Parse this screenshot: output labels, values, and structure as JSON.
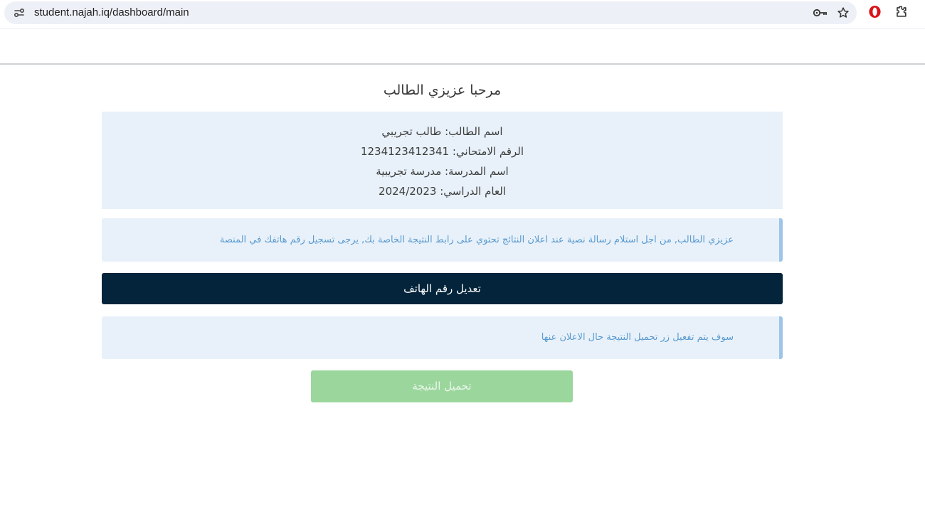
{
  "browser": {
    "url": "student.najah.iq/dashboard/main",
    "icons": [
      "site-info-icon",
      "password-key-icon",
      "bookmark-star-icon",
      "opera-icon",
      "extensions-icon"
    ]
  },
  "main": {
    "welcome_title": "مرحبا عزيزي الطالب",
    "student_info": {
      "name_line": "اسم الطالب: طالب تجريبي",
      "exam_number_line": "الرقم الامتحاني: 1234123412341",
      "school_line": "اسم المدرسة: مدرسة تجريبية",
      "academic_year_line": "العام الدراسي: 2024/2023"
    },
    "sms_notice": "عزيزي الطالب, من اجل استلام رسالة نصية عند اعلان النتائج تحتوي على رابط النتيجة الخاصة بك, يرجى تسجيل رقم هاتفك في المنصة",
    "edit_phone_label": "تعديل رقم الهاتف",
    "download_notice": "سوف يتم تفعيل زر تحميل النتيجة حال الاعلان عنها",
    "download_label": "تحميل النتيجة"
  },
  "colors": {
    "panel_bg": "#e8f1f9",
    "alert_text": "#5a9ad0",
    "alert_border": "#9ec5e8",
    "primary_button": "#03243a",
    "disabled_success_button": "#9bd79d"
  }
}
